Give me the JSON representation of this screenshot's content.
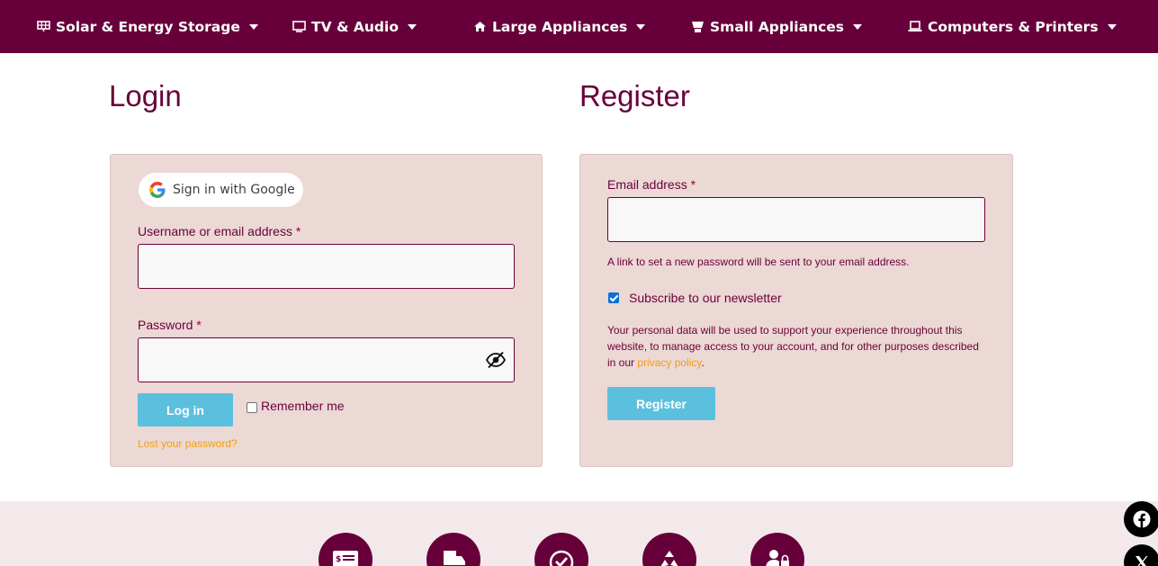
{
  "nav": {
    "items": [
      {
        "label": "Solar & Energy Storage",
        "icon": "solar-panel-icon"
      },
      {
        "label": "TV & Audio",
        "icon": "tv-icon"
      },
      {
        "label": "Large Appliances",
        "icon": "home-icon"
      },
      {
        "label": "Small Appliances",
        "icon": "blender-icon"
      },
      {
        "label": "Computers & Printers",
        "icon": "laptop-icon"
      }
    ]
  },
  "login": {
    "title": "Login",
    "google_label": "Sign in with Google",
    "username_label": "Username or email address",
    "password_label": "Password",
    "required_mark": "*",
    "username_value": "",
    "password_value": "",
    "submit_label": "Log in",
    "remember_label": "Remember me",
    "remember_checked": false,
    "lost_password": "Lost your password?"
  },
  "register": {
    "title": "Register",
    "email_label": "Email address",
    "required_mark": "*",
    "email_value": "",
    "password_note": "A link to set a new password will be sent to your email address.",
    "newsletter_label": "Subscribe to our newsletter",
    "newsletter_checked": true,
    "privacy_text": "Your personal data will be used to support your experience throughout this website, to manage access to your account, and for other purposes described in our",
    "privacy_link": "privacy policy",
    "privacy_end": ".",
    "submit_label": "Register"
  },
  "footer": {
    "icons": [
      "invoice-icon",
      "delivery-truck-icon",
      "check-icon",
      "recycle-icon",
      "user-lock-icon"
    ],
    "social": [
      "facebook-icon",
      "x-icon"
    ]
  },
  "colors": {
    "brand": "#67003a",
    "button": "#5bc0de",
    "panel": "#ecd8d5",
    "link": "#f0a010"
  }
}
